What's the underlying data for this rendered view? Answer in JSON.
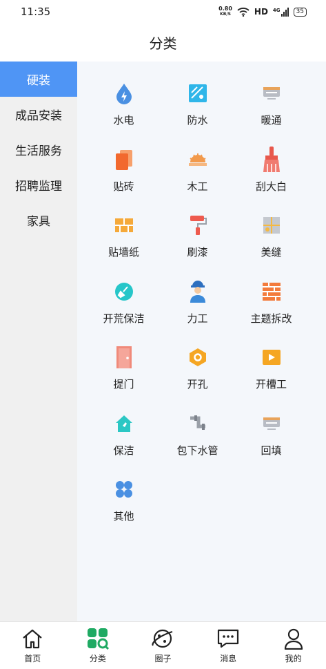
{
  "status": {
    "time": "11:35",
    "net_speed_top": "0.80",
    "net_speed_bottom": "KB/S",
    "hd": "HD",
    "signal": "4G",
    "battery": "35"
  },
  "header": {
    "title": "分类"
  },
  "sidebar": {
    "items": [
      {
        "label": "硬装",
        "active": true
      },
      {
        "label": "成品安装"
      },
      {
        "label": "生活服务"
      },
      {
        "label": "招聘监理"
      },
      {
        "label": "家具"
      }
    ]
  },
  "categories": [
    {
      "label": "水电",
      "icon": "water-drop-icon"
    },
    {
      "label": "防水",
      "icon": "waterproof-icon"
    },
    {
      "label": "暖通",
      "icon": "hvac-icon"
    },
    {
      "label": "贴砖",
      "icon": "tile-icon"
    },
    {
      "label": "木工",
      "icon": "saw-icon"
    },
    {
      "label": "刮大白",
      "icon": "brush-icon"
    },
    {
      "label": "贴墙纸",
      "icon": "wall-brick-icon"
    },
    {
      "label": "刷漆",
      "icon": "paint-roller-icon"
    },
    {
      "label": "美缝",
      "icon": "caulk-icon"
    },
    {
      "label": "开荒保洁",
      "icon": "broom-icon"
    },
    {
      "label": "力工",
      "icon": "worker-icon"
    },
    {
      "label": "主题拆改",
      "icon": "demolition-icon"
    },
    {
      "label": "提门",
      "icon": "door-icon"
    },
    {
      "label": "开孔",
      "icon": "hex-nut-icon"
    },
    {
      "label": "开槽工",
      "icon": "groove-icon"
    },
    {
      "label": "保洁",
      "icon": "house-clean-icon"
    },
    {
      "label": "包下水管",
      "icon": "pipe-icon"
    },
    {
      "label": "回填",
      "icon": "backfill-icon"
    },
    {
      "label": "其他",
      "icon": "clover-icon"
    }
  ],
  "tabbar": {
    "items": [
      {
        "label": "首页",
        "icon": "home-icon"
      },
      {
        "label": "分类",
        "icon": "category-icon",
        "active": true
      },
      {
        "label": "圈子",
        "icon": "planet-icon"
      },
      {
        "label": "消息",
        "icon": "message-icon"
      },
      {
        "label": "我的",
        "icon": "profile-icon"
      }
    ]
  },
  "colors": {
    "accent": "#4f95f5",
    "active_tab": "#1faa63",
    "sidebar_bg": "#f0f0f0",
    "content_bg": "#f4f7fb"
  }
}
